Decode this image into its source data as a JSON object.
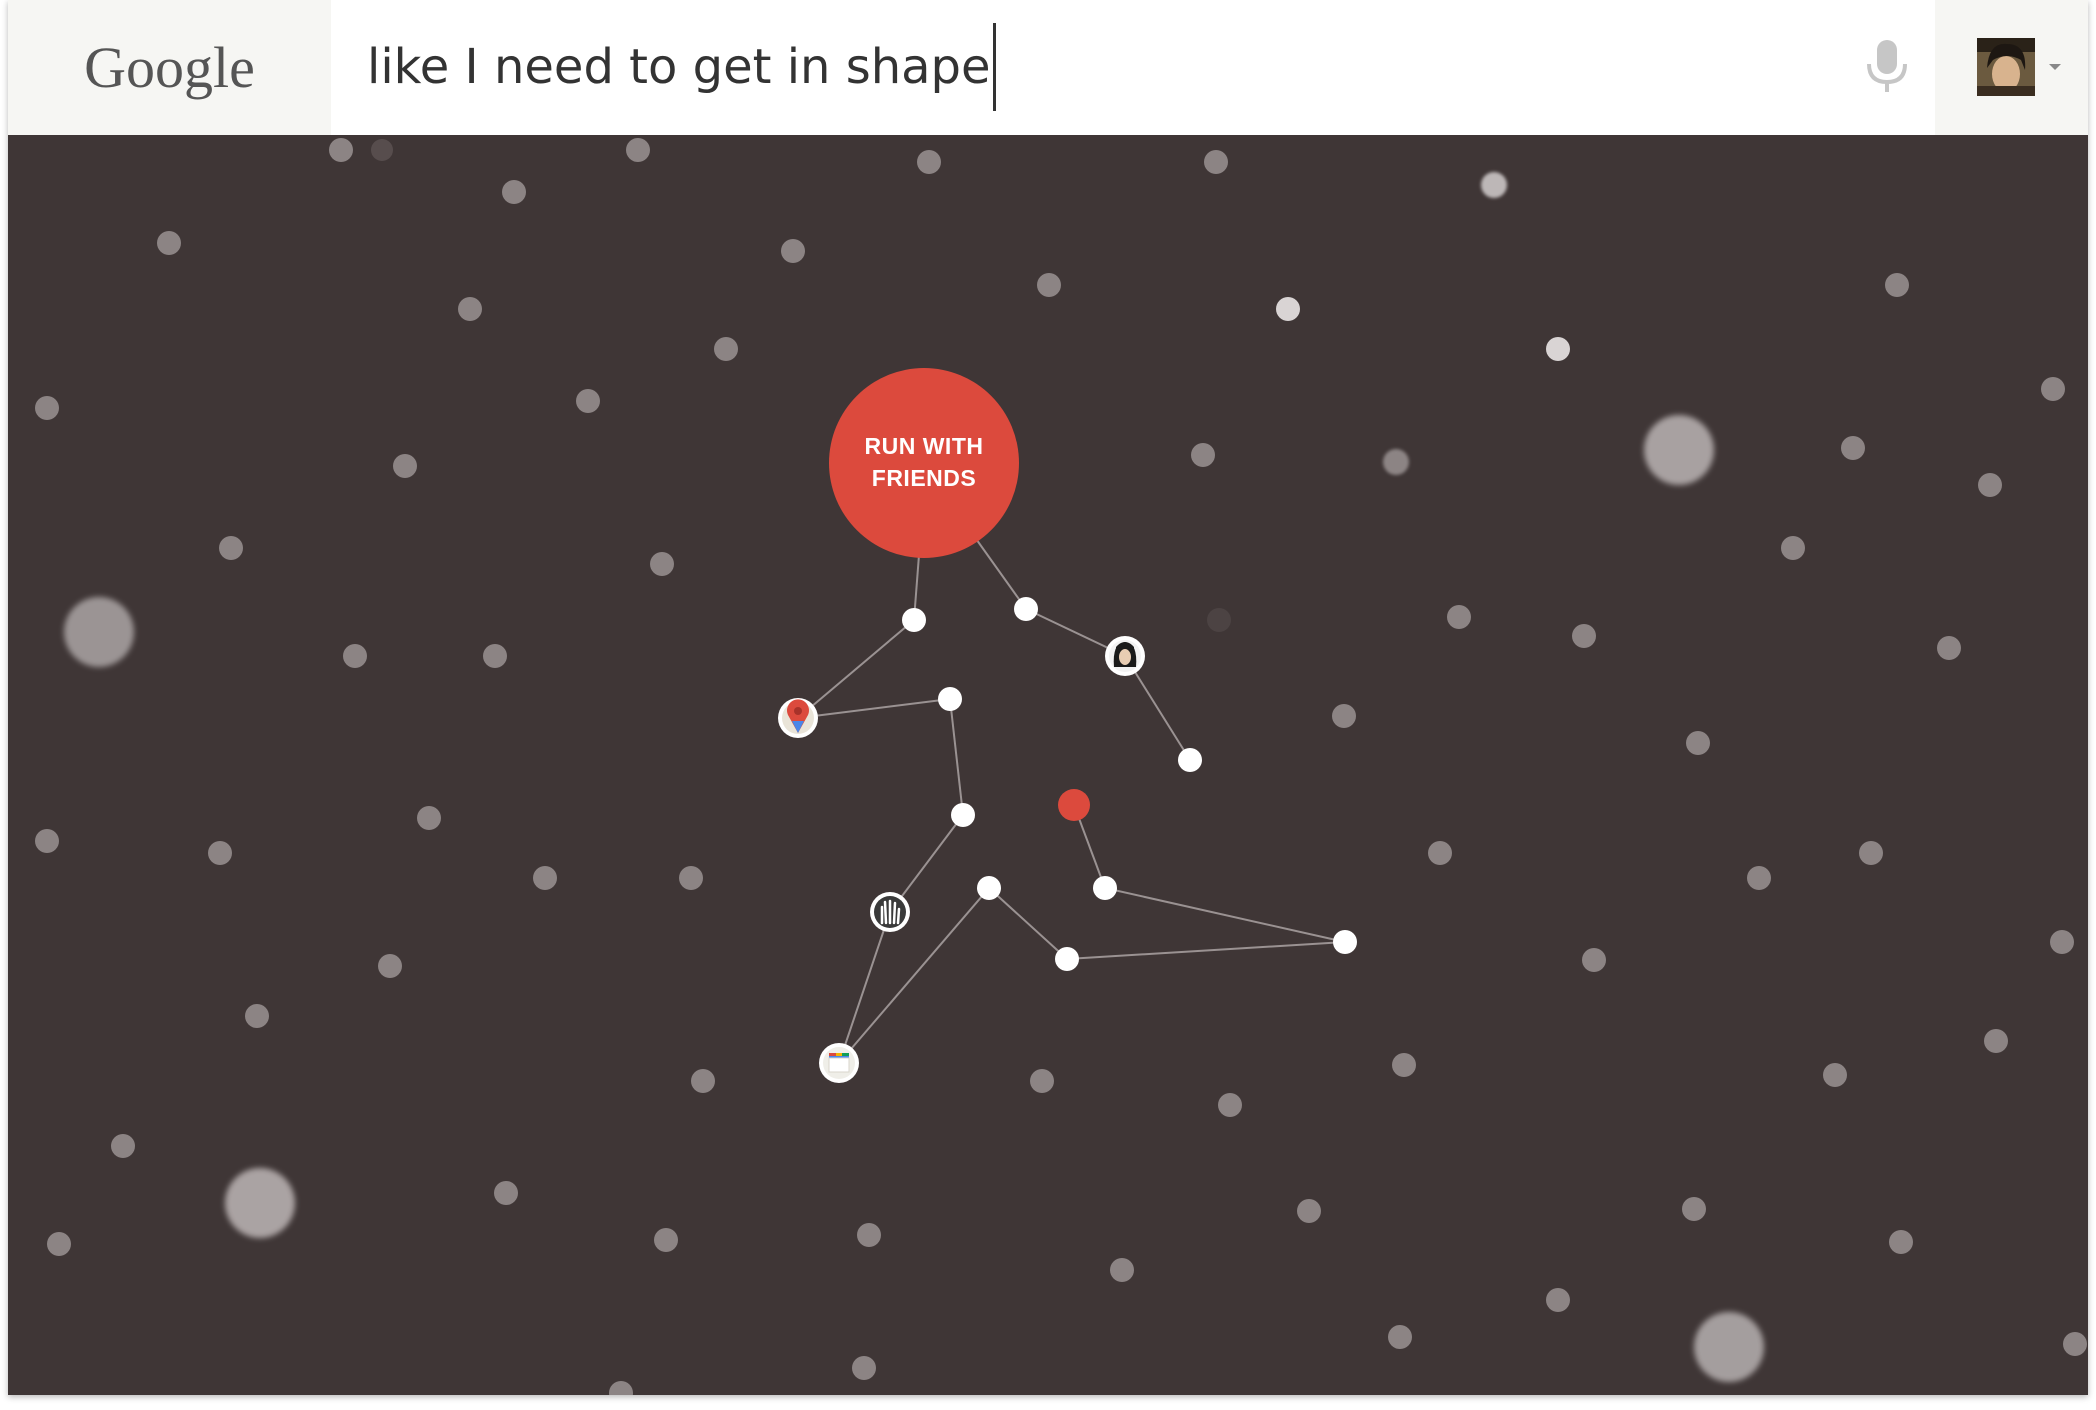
{
  "header": {
    "logo_text": "Google",
    "search_query": "like I need to get in shape",
    "mic_icon": "microphone-icon",
    "account_icon": "account-avatar"
  },
  "main": {
    "bubble_line1": "RUN WITH",
    "bubble_line2": "FRIENDS",
    "node_icons": [
      "maps-pin-icon",
      "friend-avatar-icon",
      "hand-photo-icon",
      "calendar-icon"
    ]
  },
  "colors": {
    "background": "#3f3636",
    "accent_red": "#dc4a3d",
    "topbar": "#f6f6f3",
    "dot": "#8c8484",
    "node": "#ffffff",
    "edge": "#9a9292"
  }
}
